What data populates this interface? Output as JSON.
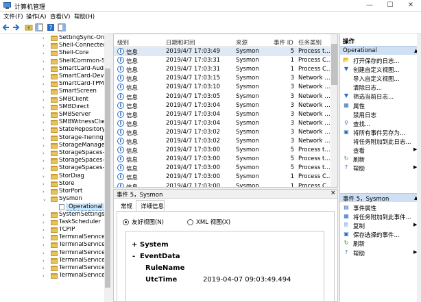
{
  "window": {
    "title": "计算机管理"
  },
  "menu": [
    "文件(F)",
    "操作(A)",
    "查看(V)",
    "帮助(H)"
  ],
  "tree": {
    "items": [
      {
        "label": "SettingSync-OneD",
        "expand": "›"
      },
      {
        "label": "Shell-ConnectedA",
        "expand": "›"
      },
      {
        "label": "Shell-Core",
        "expand": "›"
      },
      {
        "label": "ShellCommon-Star",
        "expand": "›"
      },
      {
        "label": "SmartCard-Audit",
        "expand": "›"
      },
      {
        "label": "SmartCard-Device",
        "expand": "›"
      },
      {
        "label": "SmartCard-TPM-V",
        "expand": "›"
      },
      {
        "label": "SmartScreen",
        "expand": "›"
      },
      {
        "label": "SMBClient",
        "expand": "›"
      },
      {
        "label": "SMBDirect",
        "expand": "›"
      },
      {
        "label": "SMBServer",
        "expand": "›"
      },
      {
        "label": "SMBWitnessClient",
        "expand": "›"
      },
      {
        "label": "StateRepository",
        "expand": "›"
      },
      {
        "label": "Storage-Tiering",
        "expand": "›"
      },
      {
        "label": "StorageManageme",
        "expand": "›"
      },
      {
        "label": "StorageSpaces-Dri",
        "expand": "›"
      },
      {
        "label": "StorageSpaces-Ma",
        "expand": "›"
      },
      {
        "label": "StorageSpaces-Spa",
        "expand": "›"
      },
      {
        "label": "StorDiag",
        "expand": "›"
      },
      {
        "label": "Store",
        "expand": "›"
      },
      {
        "label": "StorPort",
        "expand": "›"
      },
      {
        "label": "Sysmon",
        "expand": "⌄"
      },
      {
        "label": "Operational",
        "expand": ""
      },
      {
        "label": "SystemSettingsThr",
        "expand": "›"
      },
      {
        "label": "TaskScheduler",
        "expand": "›"
      },
      {
        "label": "TCPIP",
        "expand": "›"
      },
      {
        "label": "TerminalServices-C",
        "expand": "›"
      },
      {
        "label": "TerminalServices-C",
        "expand": "›"
      },
      {
        "label": "TerminalServices-L",
        "expand": "›"
      },
      {
        "label": "TerminalServices-F",
        "expand": "›"
      },
      {
        "label": "TerminalServices-F",
        "expand": "›"
      },
      {
        "label": "TerminalServices-F",
        "expand": "›"
      }
    ]
  },
  "list": {
    "headers": [
      "级别",
      "日期和时间",
      "来源",
      "事件 ID",
      "任务类别"
    ],
    "rows": [
      [
        "信息",
        "2019/4/7 17:03:49",
        "Sysmon",
        "5",
        "Process t…"
      ],
      [
        "信息",
        "2019/4/7 17:03:31",
        "Sysmon",
        "1",
        "Process C…"
      ],
      [
        "信息",
        "2019/4/7 17:03:31",
        "Sysmon",
        "1",
        "Process C…"
      ],
      [
        "信息",
        "2019/4/7 17:03:15",
        "Sysmon",
        "3",
        "Network …"
      ],
      [
        "信息",
        "2019/4/7 17:03:10",
        "Sysmon",
        "3",
        "Network …"
      ],
      [
        "信息",
        "2019/4/7 17:03:05",
        "Sysmon",
        "3",
        "Network …"
      ],
      [
        "信息",
        "2019/4/7 17:03:04",
        "Sysmon",
        "3",
        "Network …"
      ],
      [
        "信息",
        "2019/4/7 17:03:04",
        "Sysmon",
        "3",
        "Network …"
      ],
      [
        "信息",
        "2019/4/7 17:03:04",
        "Sysmon",
        "3",
        "Network …"
      ],
      [
        "信息",
        "2019/4/7 17:03:02",
        "Sysmon",
        "3",
        "Network …"
      ],
      [
        "信息",
        "2019/4/7 17:03:02",
        "Sysmon",
        "3",
        "Network …"
      ],
      [
        "信息",
        "2019/4/7 17:03:00",
        "Sysmon",
        "5",
        "Process t…"
      ],
      [
        "信息",
        "2019/4/7 17:03:00",
        "Sysmon",
        "5",
        "Process t…"
      ],
      [
        "信息",
        "2019/4/7 17:03:00",
        "Sysmon",
        "5",
        "Process t…"
      ],
      [
        "信息",
        "2019/4/7 17:03:00",
        "Sysmon",
        "1",
        "Process C…"
      ],
      [
        "信息",
        "2019/4/7 17:03:00",
        "Sysmon",
        "1",
        "Process C…"
      ]
    ]
  },
  "detail": {
    "header": "事件 5，Sysmon",
    "tabs": [
      "常规",
      "详细信息"
    ],
    "radio_friendly": "友好视图(N)",
    "radio_xml": "XML 视图(X)",
    "tree": {
      "system_toggle": "+",
      "system": "System",
      "eventdata_toggle": "-",
      "eventdata": "EventData",
      "rulename": "RuleName",
      "utctime": "UtcTime",
      "utctime_value": "2019-04-07 09:03:49.494"
    }
  },
  "actions": {
    "title": "操作",
    "section1": "Operational",
    "section1_items": [
      {
        "icon": "open-log-icon",
        "glyph": "📂",
        "label": "打开保存的日志..."
      },
      {
        "icon": "filter-create-icon",
        "glyph": "▼",
        "label": "创建自定义视图..."
      },
      {
        "icon": "import-icon",
        "glyph": "",
        "label": "导入自定义视图..."
      },
      {
        "icon": "",
        "glyph": "",
        "label": "清除日志..."
      },
      {
        "icon": "filter-icon",
        "glyph": "▼",
        "label": "筛选当前日志..."
      },
      {
        "icon": "properties-icon",
        "glyph": "▦",
        "label": "属性"
      },
      {
        "icon": "",
        "glyph": "",
        "label": "禁用日志"
      },
      {
        "icon": "find-icon",
        "glyph": "⚲",
        "label": "查找..."
      },
      {
        "icon": "save-icon",
        "glyph": "▣",
        "label": "将所有事件另存为..."
      },
      {
        "icon": "",
        "glyph": "",
        "label": "将任务附加到此日志..."
      },
      {
        "icon": "",
        "glyph": "",
        "label": "查看",
        "arrow": "▶"
      },
      {
        "icon": "refresh-icon",
        "glyph": "↻",
        "label": "刷新"
      },
      {
        "icon": "help-icon",
        "glyph": "?",
        "label": "帮助",
        "arrow": "▶"
      }
    ],
    "section2": "事件 5，Sysmon",
    "section2_items": [
      {
        "icon": "event-properties-icon",
        "glyph": "▤",
        "label": "事件属性"
      },
      {
        "icon": "attach-task-icon",
        "glyph": "▦",
        "label": "将任务附加到此事件..."
      },
      {
        "icon": "copy-icon",
        "glyph": "⎘",
        "label": "复制",
        "arrow": "▶"
      },
      {
        "icon": "save-selected-icon",
        "glyph": "▣",
        "label": "保存选择的事件..."
      },
      {
        "icon": "refresh-icon",
        "glyph": "↻",
        "label": "刷新"
      },
      {
        "icon": "help-icon",
        "glyph": "?",
        "label": "帮助",
        "arrow": "▶"
      }
    ]
  },
  "colors": {
    "info_icon": "#2a6bc0",
    "folder": "#e8c25a",
    "action_band": "#cfe0f5",
    "selection": "#cce8ff"
  }
}
